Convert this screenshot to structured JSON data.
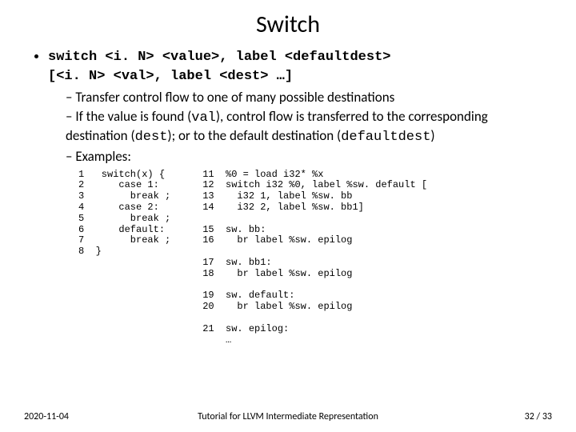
{
  "title": "Switch",
  "syntax_line1": "switch <i. N> <value>, label <defaultdest>",
  "syntax_line2": "                      [<i. N> <val>, label <dest> …]",
  "sub1": "Transfer control flow to one of many possible destinations",
  "sub2_a": "If the value is found (",
  "sub2_val": "val",
  "sub2_b": "), control flow is transferred to the corresponding destination (",
  "sub2_dest": "dest",
  "sub2_c": "); or to the default destination (",
  "sub2_def": "defaultdest",
  "sub2_d": ")",
  "sub3": "Examples:",
  "code_left": "1   switch(x) {\n2      case 1:\n3        break ;\n4      case 2:\n5        break ;\n6      default:\n7        break ;\n8  }",
  "code_right": "11  %0 = load i32* %x\n12  switch i32 %0, label %sw. default [\n13    i32 1, label %sw. bb\n14    i32 2, label %sw. bb1]\n\n15  sw. bb:\n16    br label %sw. epilog\n\n17  sw. bb1:\n18    br label %sw. epilog\n\n19  sw. default:\n20    br label %sw. epilog\n\n21  sw. epilog:\n    …",
  "footer": {
    "date": "2020-11-04",
    "caption": "Tutorial for LLVM Intermediate Representation",
    "pager": "32  / 33"
  }
}
